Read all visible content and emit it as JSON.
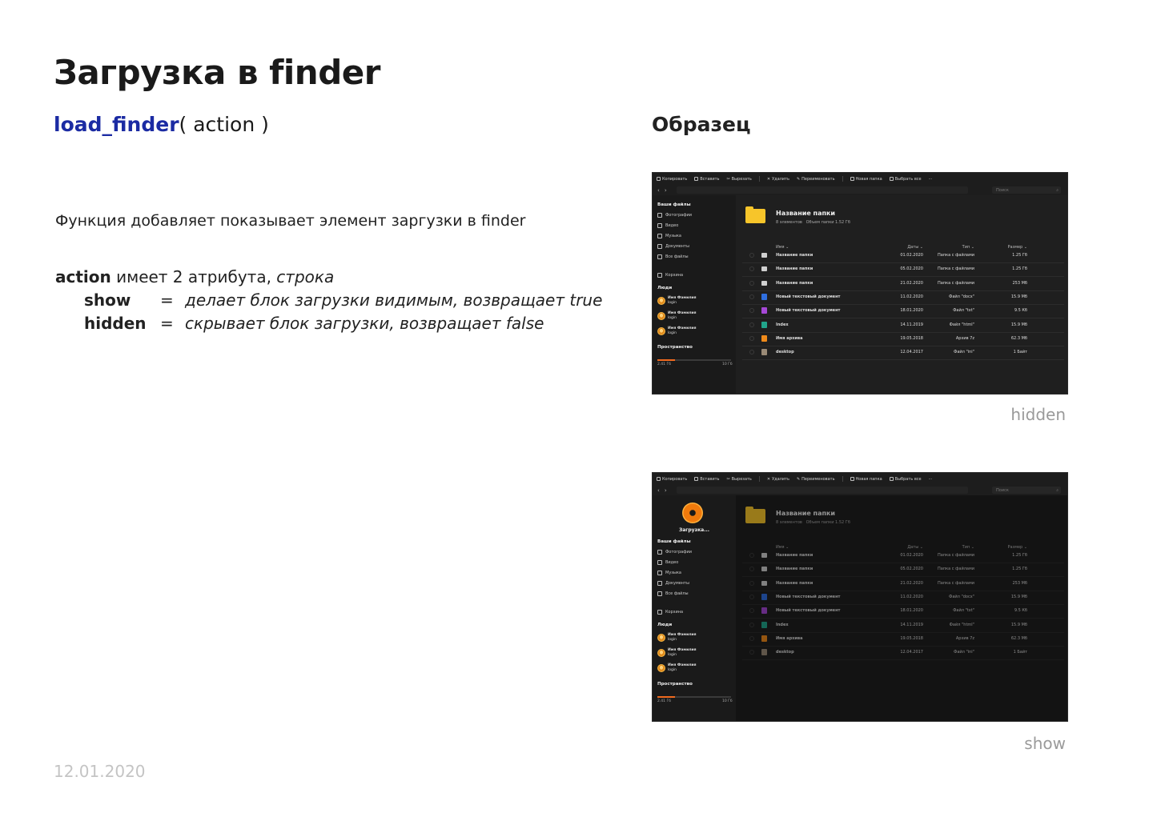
{
  "slide": {
    "title": "Загрузка в finder",
    "signature_fn": "load_finder",
    "signature_args": "( action )",
    "sample_heading": "Образец",
    "description": "Функция добавляет показывает элемент заргузки в finder",
    "attr_intro_kw": "action",
    "attr_intro_mid": " имеет 2 атрибута, ",
    "attr_intro_type": "строка",
    "attrs": [
      {
        "key": "show",
        "eq": "=",
        "value": "делает блок загрузки видимым, возвращает true"
      },
      {
        "key": "hidden",
        "eq": "=",
        "value": "скрывает блок загрузки, возвращает false"
      }
    ],
    "caption_hidden": "hidden",
    "caption_show": "show",
    "date": "12.01.2020"
  },
  "finder": {
    "toolbar": [
      "Копировать",
      "Вставить",
      "Вырезать",
      "Удалить",
      "Переименовать",
      "Новая папка",
      "Выбрать все",
      "···"
    ],
    "nav_back": "‹",
    "nav_fwd": "›",
    "search_placeholder": "Поиск",
    "loader_label": "Загрузка...",
    "sidebar": {
      "files_heading": "Ваши файлы",
      "items": [
        "Фотографии",
        "Видео",
        "Музыка",
        "Документы",
        "Все файлы"
      ],
      "trash": "Корзина",
      "people_heading": "Люди",
      "people": [
        {
          "name": "Имя Фамилия",
          "login": "login"
        },
        {
          "name": "Имя Фамилия",
          "login": "login"
        },
        {
          "name": "Имя Фамилия",
          "login": "login"
        }
      ],
      "storage_heading": "Пространство",
      "storage_used": "2.41 Гб",
      "storage_total": "10 Гб",
      "storage_fraction": 0.24
    },
    "folder_title": "Название папки",
    "folder_count": "8 элементов",
    "folder_size": "Объем папки 1.52 Гб",
    "columns": {
      "name": "Имя ⌄",
      "date": "Даты ⌄",
      "type": "Тип ⌄",
      "size": "Размер ⌄"
    },
    "colors": {
      "folder": "#f7c52a",
      "accent": "#f06a1f",
      "bg": "#1d1d1d"
    },
    "rows_hidden": [
      {
        "name": "Название папки",
        "date": "01.02.2020",
        "type": "Папка с файлами",
        "size": "1.25 Гб",
        "icon": "folder",
        "color": "#cfcfcf"
      },
      {
        "name": "Название папки",
        "date": "05.02.2020",
        "type": "Папка с файлами",
        "size": "1.25 Гб",
        "icon": "folder",
        "color": "#cfcfcf"
      },
      {
        "name": "Название папки",
        "date": "21.02.2020",
        "type": "Папка с файлами",
        "size": "253 Мб",
        "icon": "folder",
        "color": "#cfcfcf"
      },
      {
        "name": "Новый текстовый документ",
        "date": "11.02.2020",
        "type": "Файл \"docx\"",
        "size": "15.9 Мб",
        "icon": "docx",
        "color": "#2f6fe0"
      },
      {
        "name": "Новый текстовый документ",
        "date": "18.01.2020",
        "type": "Файл \"txt\"",
        "size": "9.5 Кб",
        "icon": "txt",
        "color": "#a548d6"
      },
      {
        "name": "Index",
        "date": "14.11.2019",
        "type": "Файл \"html\"",
        "size": "15.9 Мб",
        "icon": "html",
        "color": "#21a58b"
      },
      {
        "name": "Имя архива",
        "date": "19.05.2018",
        "type": "Архив 7z",
        "size": "62.3 Мб",
        "icon": "archive",
        "color": "#ef8a1a"
      },
      {
        "name": "desktop",
        "date": "12.04.2017",
        "type": "Файл \"ini\"",
        "size": "1 Байт",
        "icon": "ini",
        "color": "#9a8a76"
      }
    ]
  }
}
